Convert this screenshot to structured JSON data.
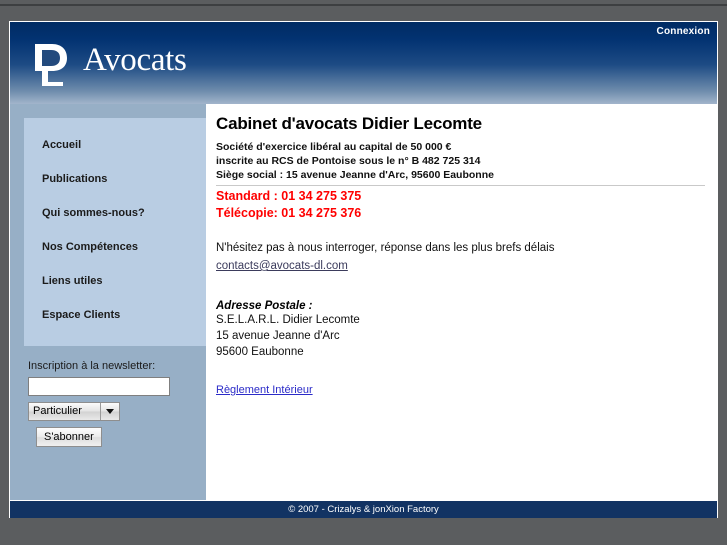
{
  "header": {
    "connexion_label": "Connexion",
    "logo_text": "Avocats",
    "logo_monogram": "DL"
  },
  "sidebar": {
    "items": [
      {
        "label": "Accueil"
      },
      {
        "label": "Publications"
      },
      {
        "label": "Qui sommes-nous?"
      },
      {
        "label": "Nos Compétences"
      },
      {
        "label": "Liens utiles"
      },
      {
        "label": "Espace Clients"
      }
    ],
    "newsletter": {
      "label": "Inscription à la newsletter:",
      "input_value": "",
      "input_placeholder": "",
      "select_value": "Particulier",
      "select_options": [
        "Particulier"
      ],
      "button_label": "S'abonner"
    }
  },
  "main": {
    "title": "Cabinet d'avocats Didier Lecomte",
    "legal_lines": [
      "Société d'exercice libéral au capital de 50 000 €",
      "inscrite au RCS de Pontoise sous le n° B 482 725 314",
      "Siège social : 15 avenue Jeanne d'Arc, 95600 Eaubonne"
    ],
    "phone_standard": "Standard : 01 34 275 375",
    "phone_fax": "Télécopie: 01 34 275 376",
    "intro": "N'hésitez pas à nous interroger, réponse dans les plus brefs délais",
    "email": "contacts@avocats-dl.com",
    "address_title": "Adresse Postale :",
    "address_lines": [
      "S.E.L.A.R.L. Didier Lecomte",
      "15 avenue Jeanne d'Arc",
      "95600 Eaubonne"
    ],
    "reglement_link": "Règlement Intérieur"
  },
  "footer": {
    "text": "© 2007 - Crizalys & jonXion Factory"
  },
  "colors": {
    "header_top": "#002b63",
    "header_bottom": "#a2b5cb",
    "sidebar": "#97afc6",
    "menu_box": "#b9cde3",
    "accent_red": "#ff0000",
    "link_blue": "#2b2bc8",
    "footer": "#123363",
    "page_bg": "#5b5d5f"
  }
}
